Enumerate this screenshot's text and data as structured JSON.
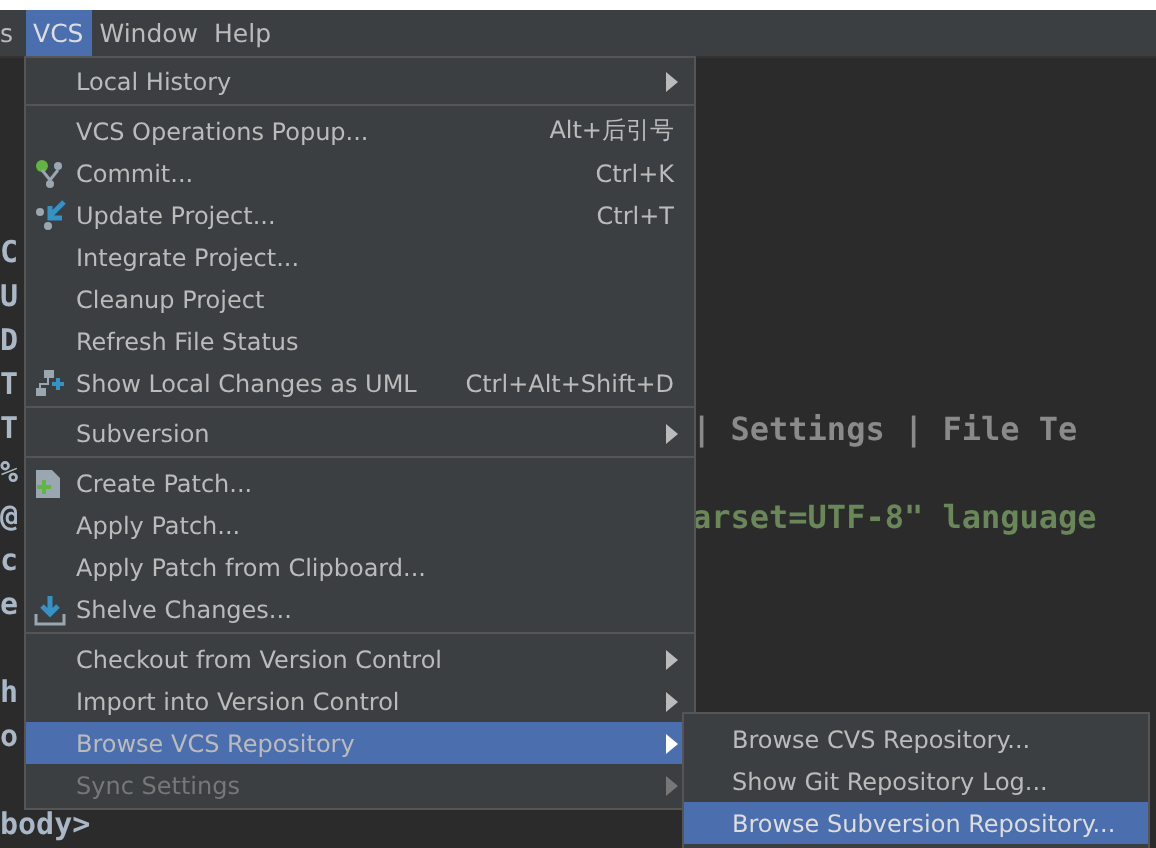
{
  "menu_bar": [
    {
      "label": "s",
      "selected": false
    },
    {
      "label": "VCS",
      "selected": true
    },
    {
      "label": "Window",
      "selected": false
    },
    {
      "label": "Help",
      "selected": false
    }
  ],
  "editor": {
    "lines": [
      {
        "left": "C"
      },
      {
        "left": "U"
      },
      {
        "left": "D"
      },
      {
        "left": "T"
      },
      {
        "left": "T",
        "right": "| Settings | File Te"
      },
      {
        "left": "%"
      },
      {
        "left": "@",
        "right": "arset=UTF-8\" language"
      },
      {
        "left": "c"
      },
      {
        "left": "e"
      },
      {
        "left": "h"
      },
      {
        "left": "o"
      },
      {
        "left": "body>"
      }
    ]
  },
  "vcs_menu": {
    "items": [
      {
        "kind": "item",
        "label": "Local History",
        "submenu": true,
        "disabled": false,
        "selected": false
      },
      {
        "kind": "separator"
      },
      {
        "kind": "item",
        "label": "VCS Operations Popup...",
        "shortcut": "Alt+后引号",
        "submenu": false,
        "disabled": false,
        "selected": false
      },
      {
        "kind": "item",
        "label": "Commit...",
        "shortcut": "Ctrl+K",
        "submenu": false,
        "disabled": false,
        "selected": false
      },
      {
        "kind": "item",
        "label": "Update Project...",
        "shortcut": "Ctrl+T",
        "submenu": false,
        "disabled": false,
        "selected": false
      },
      {
        "kind": "item",
        "label": "Integrate Project...",
        "submenu": false,
        "disabled": false,
        "selected": false
      },
      {
        "kind": "item",
        "label": "Cleanup Project",
        "submenu": false,
        "disabled": false,
        "selected": false
      },
      {
        "kind": "item",
        "label": "Refresh File Status",
        "submenu": false,
        "disabled": false,
        "selected": false
      },
      {
        "kind": "item",
        "label": "Show Local Changes as UML",
        "shortcut": "Ctrl+Alt+Shift+D",
        "submenu": false,
        "disabled": false,
        "selected": false
      },
      {
        "kind": "separator"
      },
      {
        "kind": "item",
        "label": "Subversion",
        "submenu": true,
        "disabled": false,
        "selected": false
      },
      {
        "kind": "separator"
      },
      {
        "kind": "item",
        "label": "Create Patch...",
        "submenu": false,
        "disabled": false,
        "selected": false
      },
      {
        "kind": "item",
        "label": "Apply Patch...",
        "submenu": false,
        "disabled": false,
        "selected": false
      },
      {
        "kind": "item",
        "label": "Apply Patch from Clipboard...",
        "submenu": false,
        "disabled": false,
        "selected": false
      },
      {
        "kind": "item",
        "label": "Shelve Changes...",
        "submenu": false,
        "disabled": false,
        "selected": false
      },
      {
        "kind": "separator"
      },
      {
        "kind": "item",
        "label": "Checkout from Version Control",
        "submenu": true,
        "disabled": false,
        "selected": false
      },
      {
        "kind": "item",
        "label": "Import into Version Control",
        "submenu": true,
        "disabled": false,
        "selected": false
      },
      {
        "kind": "item",
        "label": "Browse VCS Repository",
        "submenu": true,
        "disabled": false,
        "selected": true
      },
      {
        "kind": "item",
        "label": "Sync Settings",
        "submenu": true,
        "disabled": true,
        "selected": false
      }
    ]
  },
  "browse_submenu": {
    "items": [
      {
        "label": "Browse CVS Repository...",
        "selected": false
      },
      {
        "label": "Show Git Repository Log...",
        "selected": false
      },
      {
        "label": "Browse Subversion Repository...",
        "selected": true
      }
    ]
  }
}
